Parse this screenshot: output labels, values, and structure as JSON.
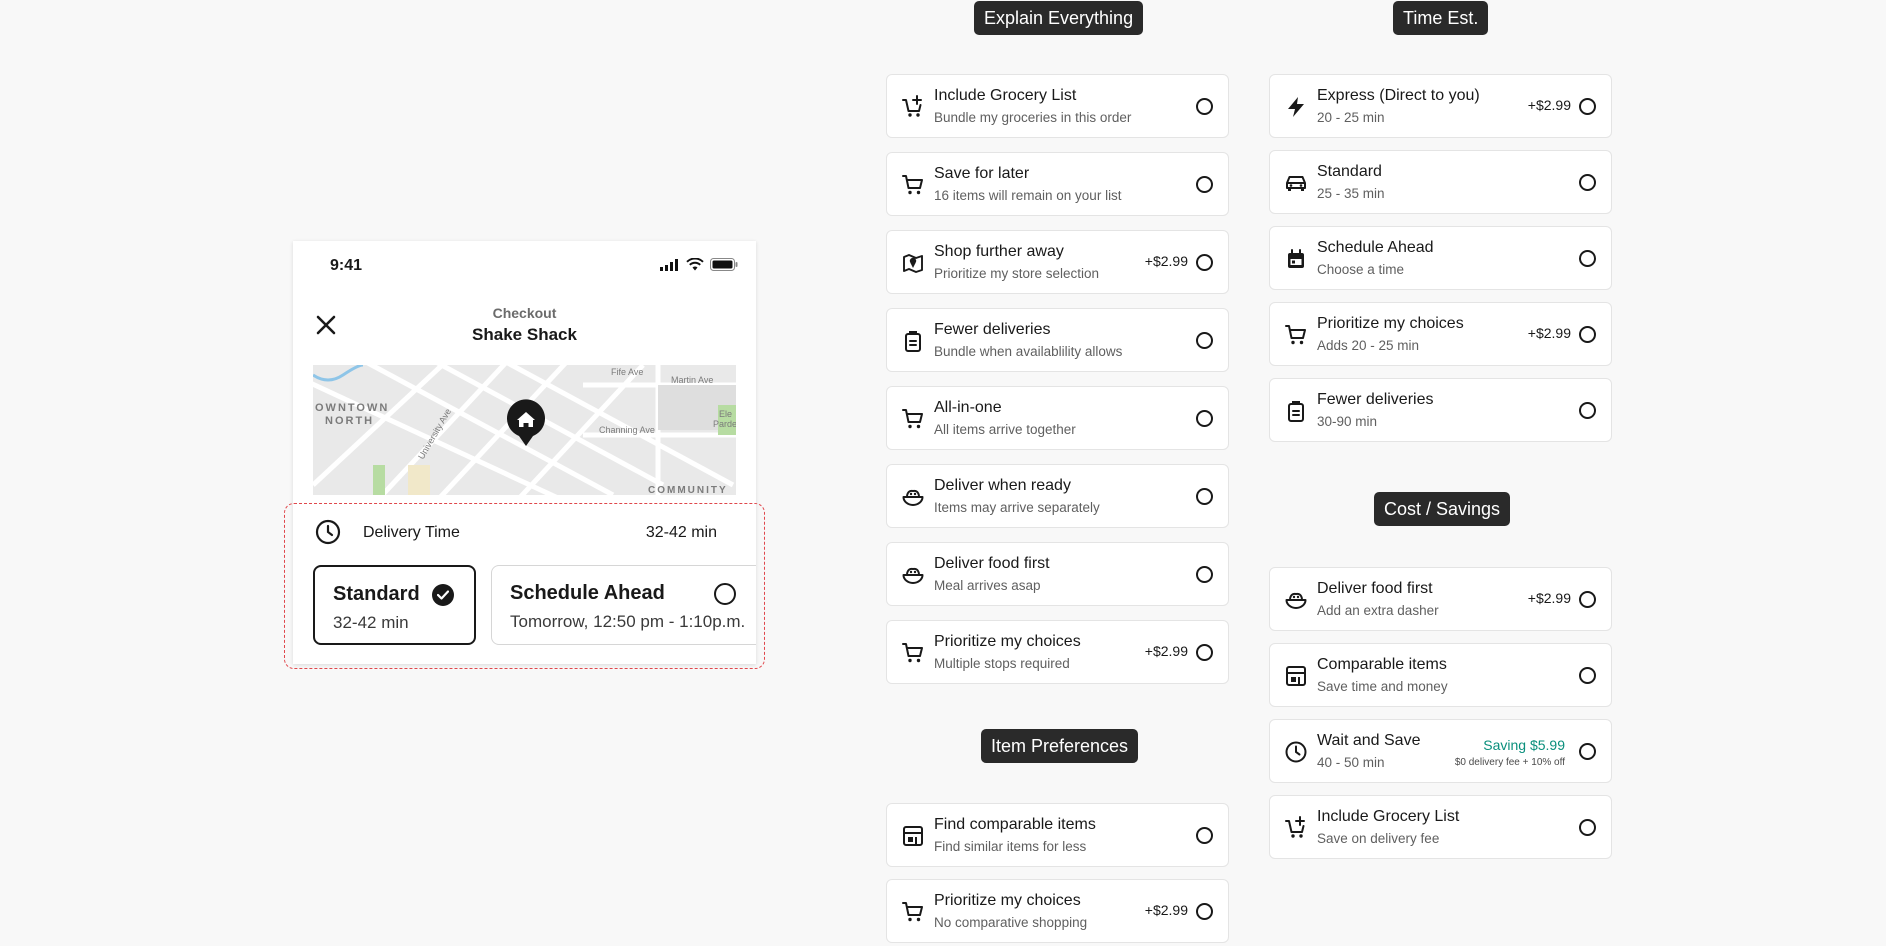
{
  "phone": {
    "time": "9:41",
    "nav_sub": "Checkout",
    "nav_title": "Shake Shack",
    "map_labels": [
      "OWNTOWN",
      "NORTH",
      "Channing Ave",
      "Fife Ave",
      "Martin Ave",
      "COMMUNITY",
      "Ele",
      "Parde",
      "University Ave"
    ],
    "delivery_label": "Delivery Time",
    "delivery_value": "32-42 min",
    "standard_title": "Standard",
    "standard_sub": "32-42 min",
    "schedule_title": "Schedule Ahead",
    "schedule_sub": "Tomorrow, 12:50 pm - 1:10p.m."
  },
  "tags": {
    "explain": "Explain Everything",
    "time": "Time Est.",
    "items": "Item Preferences",
    "cost": "Cost / Savings"
  },
  "explain_items": [
    {
      "icon": "cart-plus-icon",
      "title": "Include Grocery List",
      "sub": "Bundle my groceries in this order",
      "price": ""
    },
    {
      "icon": "cart-icon",
      "title": "Save for later",
      "sub": "16 items will remain on your list",
      "price": ""
    },
    {
      "icon": "map-pin-icon",
      "title": "Shop further away",
      "sub": "Prioritize my store selection",
      "price": "+$2.99"
    },
    {
      "icon": "bag-icon",
      "title": "Fewer deliveries",
      "sub": "Bundle when availablility allows",
      "price": ""
    },
    {
      "icon": "cart-icon",
      "title": "All-in-one",
      "sub": "All items arrive together",
      "price": ""
    },
    {
      "icon": "bowl-icon",
      "title": "Deliver when ready",
      "sub": "Items may arrive separately",
      "price": ""
    },
    {
      "icon": "bowl-icon",
      "title": "Deliver food first",
      "sub": "Meal arrives asap",
      "price": ""
    },
    {
      "icon": "cart-icon",
      "title": "Prioritize my choices",
      "sub": "Multiple stops required",
      "price": "+$2.99"
    }
  ],
  "item_prefs": [
    {
      "icon": "store-icon",
      "title": "Find comparable items",
      "sub": "Find similar items for less",
      "price": ""
    },
    {
      "icon": "cart-icon",
      "title": "Prioritize my choices",
      "sub": "No comparative shopping",
      "price": "+$2.99"
    }
  ],
  "time_items": [
    {
      "icon": "lightning-icon",
      "title": "Express (Direct to you)",
      "sub": "20 - 25 min",
      "price": "+$2.99"
    },
    {
      "icon": "car-icon",
      "title": "Standard",
      "sub": "25 - 35 min",
      "price": ""
    },
    {
      "icon": "calendar-icon",
      "title": "Schedule Ahead",
      "sub": "Choose a time",
      "price": ""
    },
    {
      "icon": "cart-icon",
      "title": "Prioritize my choices",
      "sub": "Adds 20 - 25 min",
      "price": "+$2.99"
    },
    {
      "icon": "bag-icon",
      "title": "Fewer deliveries",
      "sub": "30-90 min",
      "price": ""
    }
  ],
  "cost_items": [
    {
      "icon": "bowl-icon",
      "title": "Deliver food first",
      "sub": "Add an extra dasher",
      "price": "+$2.99"
    },
    {
      "icon": "store-icon",
      "title": "Comparable items",
      "sub": "Save time and money",
      "price": ""
    },
    {
      "icon": "clock-icon",
      "title": "Wait and Save",
      "sub": "40 - 50 min",
      "price": "",
      "saving": "Saving $5.99",
      "saving_note": "$0 delivery fee + 10% off"
    },
    {
      "icon": "cart-plus-icon",
      "title": "Include Grocery List",
      "sub": "Save on delivery fee",
      "price": ""
    }
  ],
  "colors": {
    "accent_red": "#e0474c",
    "saving_green": "#0a8f7c",
    "dark": "#191919"
  }
}
